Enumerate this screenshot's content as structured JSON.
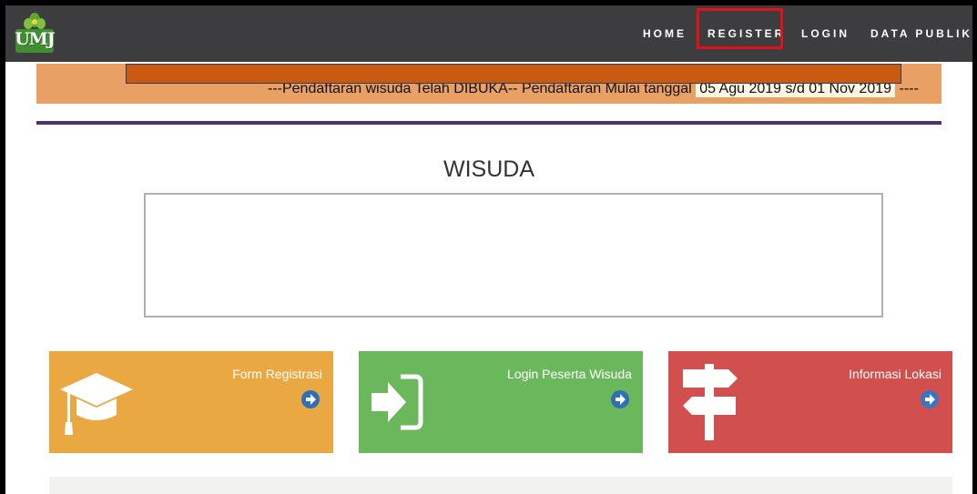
{
  "header": {
    "logo_text": "UMJ",
    "nav": [
      {
        "label": "HOME"
      },
      {
        "label": "REGISTER"
      },
      {
        "label": "LOGIN"
      },
      {
        "label": "DATA PUBLIK"
      }
    ],
    "highlight_color": "#e3101a",
    "background_color": "#3d3d3f"
  },
  "announcement": {
    "text_before": "---Pendaftaran wisuda Telah DIBUKA-- Pendaftaran Mulai tanggal",
    "dates": "05 Agu 2019 s/d 01 Nov 2019",
    "text_after": "----",
    "background_color": "#e9a064",
    "redaction_color": "#c95a10"
  },
  "page": {
    "title": "WISUDA"
  },
  "cards": [
    {
      "label": "Form Registrasi",
      "icon": "graduation-cap-icon",
      "color": "#eaa843",
      "arrow_color": "#2f6fb6"
    },
    {
      "label": "Login Peserta Wisuda",
      "icon": "sign-in-icon",
      "color": "#6ab85b",
      "arrow_color": "#2f6fb6"
    },
    {
      "label": "Informasi Lokasi",
      "icon": "signpost-icon",
      "color": "#d1504d",
      "arrow_color": "#3a75c4"
    }
  ]
}
